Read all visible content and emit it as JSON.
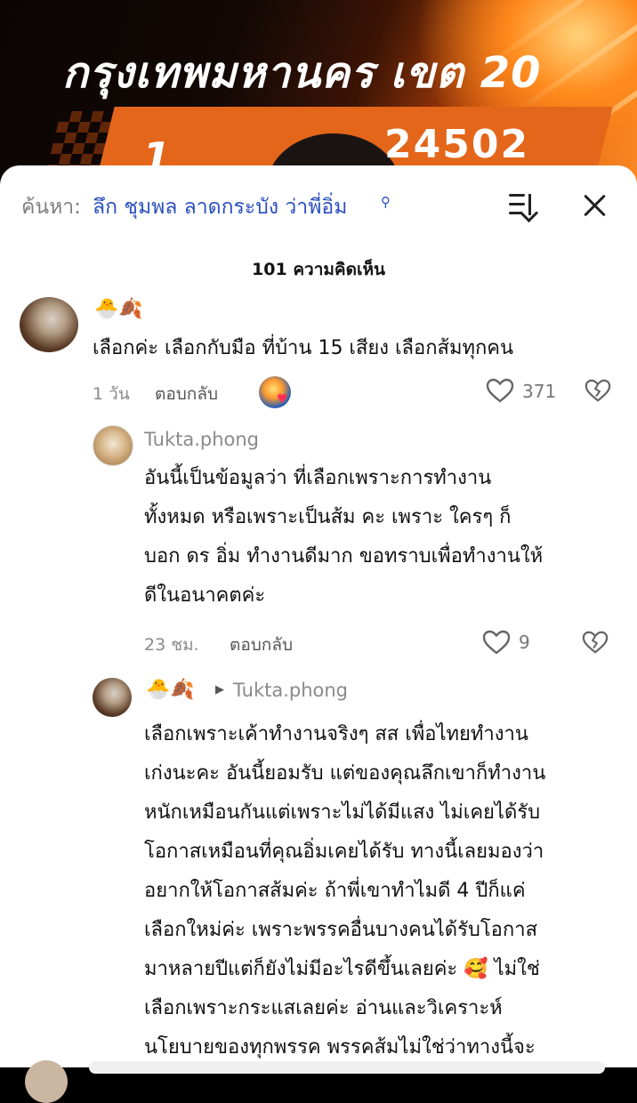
{
  "video": {
    "title": "กรุงเทพมหานคร เขต 20",
    "number": "24502",
    "rank": "1"
  },
  "search": {
    "prefix": "ค้นหา:",
    "term": "ลึก ชุมพล ลาดกระบัง ว่าพี่อิ่ม",
    "icon": "search-icon"
  },
  "comments_header": {
    "count_label": "101 ความคิดเห็น"
  },
  "comments": [
    {
      "emojis": "🐣🍂",
      "text_lines": [
        "เลือกค่ะ เลือกกับมือ ที่บ้าน 15 เสียง เลือกส้มทุกคน"
      ],
      "time": "1 วัน",
      "reply_label": "ตอบกลับ",
      "likes": "371"
    }
  ],
  "replies": [
    {
      "username": "Tukta.phong",
      "text_lines": [
        "อันนี้เป็นข้อมูลว่า ที่เลือกเพราะการทำงาน",
        "ทั้งหมด หรือเพราะเป็นส้ม คะ เพราะ ใครๆ ก็",
        "บอก ดร อิ่ม ทำงานดีมาก ขอทราบเพื่อทำงานให้",
        "ดีในอนาคตค่ะ"
      ],
      "time": "23 ชม.",
      "reply_label": "ตอบกลับ",
      "likes": "9"
    },
    {
      "emojis": "🐣🍂",
      "reply_to": "Tukta.phong",
      "text_lines": [
        "เลือกเพราะเค้าทำงานจริงๆ สส เพื่อไทยทำงาน",
        "เก่งนะคะ อันนี้ยอมรับ แต่ของคุณลึกเขาก็ทำงาน",
        "หนักเหมือนกันแต่เพราะไม่ได้มีแสง ไม่เคยได้รับ",
        "โอกาสเหมือนที่คุณอิ่มเคยได้รับ ทางนี้เลยมองว่า",
        "อยากให้โอกาสส้มค่ะ ถ้าพี่เขาทำไมดี 4 ปีก็แค่",
        "เลือกใหม่ค่ะ เพราะพรรคอื่นบางคนได้รับโอกาส",
        "มาหลายปีแต่ก็ยังไม่มีอะไรดีขึ้นเลยค่ะ 🥰 ไม่ใช่",
        "เลือกเพราะกระแสเลยค่ะ อ่านและวิเคราะห์",
        "นโยบายของทุกพรรค พรรคส้มไม่ใช่ว่าทางนี้จะ"
      ]
    }
  ],
  "icons": {
    "sort": "sort-icon",
    "close": "close-icon",
    "like": "heart-icon",
    "dislike": "broken-heart-icon"
  }
}
